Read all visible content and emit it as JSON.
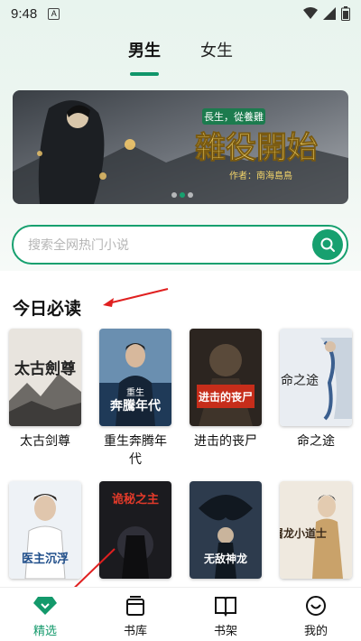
{
  "status_bar": {
    "time": "9:48",
    "notification_letter": "A"
  },
  "tabs": [
    {
      "label": "男生",
      "active": true
    },
    {
      "label": "女生",
      "active": false
    }
  ],
  "banner": {
    "title": "雜役開始",
    "subtitle": "長生，從養雞",
    "author": "作者：南海島鳥",
    "page_count": 3,
    "page_index": 1
  },
  "search": {
    "placeholder": "搜索全网热门小说"
  },
  "section": {
    "title": "今日必读"
  },
  "books_row1": [
    {
      "title": "太古剑尊"
    },
    {
      "title": "重生奔腾年代"
    },
    {
      "title": "进击的丧尸"
    },
    {
      "title": "命之途"
    }
  ],
  "covers": {
    "c1": "太古劍尊",
    "c2_top": "重生",
    "c2_main": "奔騰年代",
    "c3": "进击的丧尸",
    "c4": "命之途",
    "c5": "医主沉浮",
    "c6": "诡秘之主",
    "c7": "无敌神龙",
    "c8": "屠龙小道士"
  },
  "nav": [
    {
      "label": "精选",
      "icon": "diamond-icon",
      "active": true
    },
    {
      "label": "书库",
      "icon": "library-icon",
      "active": false
    },
    {
      "label": "书架",
      "icon": "book-icon",
      "active": false
    },
    {
      "label": "我的",
      "icon": "smile-icon",
      "active": false
    }
  ],
  "colors": {
    "accent": "#17a06f",
    "arrow": "#e02020"
  }
}
